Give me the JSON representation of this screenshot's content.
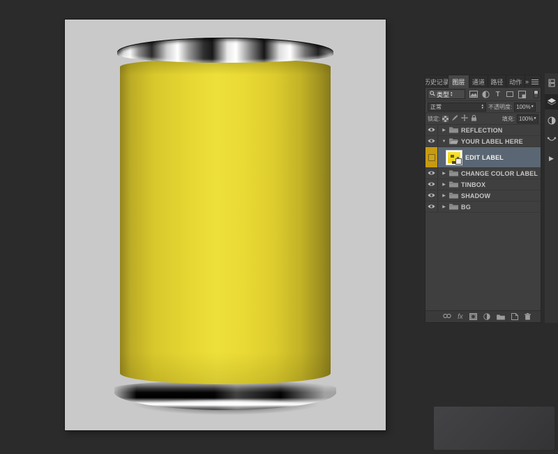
{
  "panel": {
    "tabs": [
      {
        "label": "历史记录"
      },
      {
        "label": "图层"
      },
      {
        "label": "通道"
      },
      {
        "label": "路径"
      },
      {
        "label": "动作"
      }
    ],
    "filter_kind_label": "类型",
    "blend_mode": "正常",
    "opacity_label": "不透明度:",
    "opacity_value": "100%",
    "lock_label": "锁定:",
    "fill_label": "填充:",
    "fill_value": "100%",
    "footer_fx_label": "fx",
    "layers": [
      {
        "name": "REFLECTION",
        "type": "group",
        "expanded": false,
        "visible": true
      },
      {
        "name": "YOUR LABEL HERE",
        "type": "group",
        "expanded": true,
        "visible": true
      },
      {
        "name": "EDIT LABEL",
        "type": "smart-object",
        "selected": true,
        "color_label": "#c79b10"
      },
      {
        "name": "CHANGE COLOR LABEL",
        "type": "group",
        "expanded": false,
        "visible": true
      },
      {
        "name": "TINBOX",
        "type": "group",
        "expanded": false,
        "visible": true
      },
      {
        "name": "SHADOW",
        "type": "group",
        "expanded": false,
        "visible": true
      },
      {
        "name": "BG",
        "type": "group",
        "expanded": false,
        "visible": true
      }
    ]
  },
  "colors": {
    "workspace_bg": "#2b2b2b",
    "canvas_bg": "#c9c9c9",
    "can_yellow": "#e8d831",
    "selected_row": "#5a6673",
    "layer_color_label": "#c79b10"
  }
}
